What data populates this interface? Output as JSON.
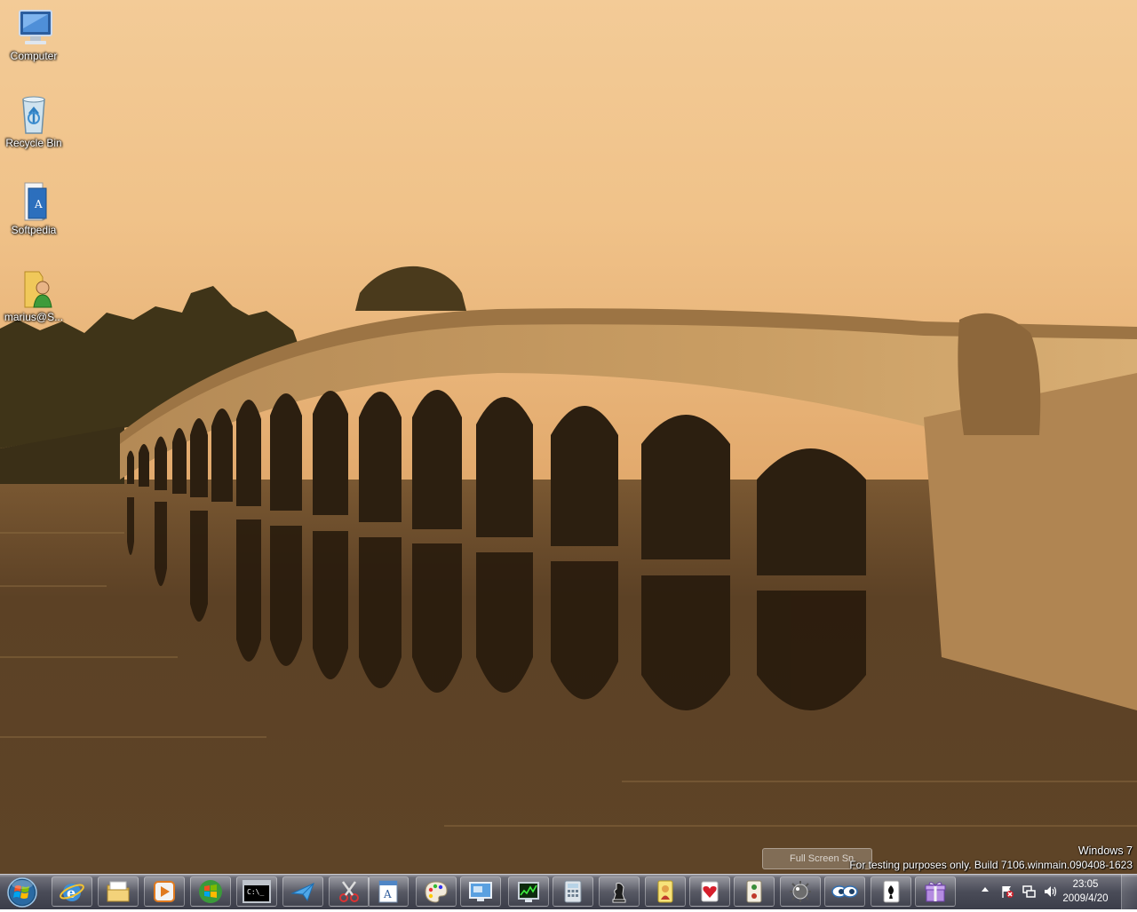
{
  "desktop": {
    "icons": [
      {
        "label": "Computer",
        "icon": "computer-icon"
      },
      {
        "label": "Recycle Bin",
        "icon": "recycle-bin-icon"
      },
      {
        "label": "Softpedia",
        "icon": "folder-document-icon"
      },
      {
        "label": "marius@S...",
        "icon": "user-folder-icon"
      }
    ]
  },
  "watermark": {
    "os_name": "Windows 7",
    "build_text": "For testing purposes only. Build 7106.winmain.090408-1623"
  },
  "ghost_window_label": "Full Screen Sn",
  "taskbar": {
    "start_icon": "windows-orb-icon",
    "pinned": [
      {
        "name": "internet-explorer",
        "icon": "internet-explorer-icon"
      },
      {
        "name": "windows-explorer",
        "icon": "folder-explorer-icon"
      },
      {
        "name": "media-player",
        "icon": "media-player-icon"
      },
      {
        "name": "windows-update",
        "icon": "windows-logo-icon"
      },
      {
        "name": "command-prompt",
        "icon": "command-prompt-icon",
        "text": "C:\\_"
      },
      {
        "name": "send-app",
        "icon": "paper-plane-icon"
      },
      {
        "name": "snipping-tool",
        "icon": "scissors-icon"
      },
      {
        "name": "wordpad",
        "icon": "wordpad-icon"
      },
      {
        "name": "paint",
        "icon": "paint-palette-icon"
      },
      {
        "name": "remote-desktop",
        "icon": "remote-desktop-icon"
      },
      {
        "name": "task-manager",
        "icon": "task-manager-icon"
      },
      {
        "name": "calculator",
        "icon": "calculator-icon"
      },
      {
        "name": "chess",
        "icon": "chess-icon"
      },
      {
        "name": "freecell",
        "icon": "freecell-icon"
      },
      {
        "name": "hearts",
        "icon": "hearts-icon"
      },
      {
        "name": "mahjong",
        "icon": "mahjong-icon"
      },
      {
        "name": "minesweeper",
        "icon": "minesweeper-icon"
      },
      {
        "name": "magnifier",
        "icon": "eyes-icon"
      },
      {
        "name": "solitaire",
        "icon": "solitaire-icon"
      },
      {
        "name": "purble-place",
        "icon": "gift-box-icon"
      }
    ],
    "tray": {
      "show_hidden_icon": "up-arrow-icon",
      "action_center_icon": "flag-error-icon",
      "network_icon": "network-icon",
      "volume_icon": "speaker-icon",
      "time": "23:05",
      "date": "2009/4/20"
    }
  },
  "colors": {
    "sky_top": "#f2c893",
    "water": "#5f4326",
    "taskbar": "#4a4c58"
  }
}
